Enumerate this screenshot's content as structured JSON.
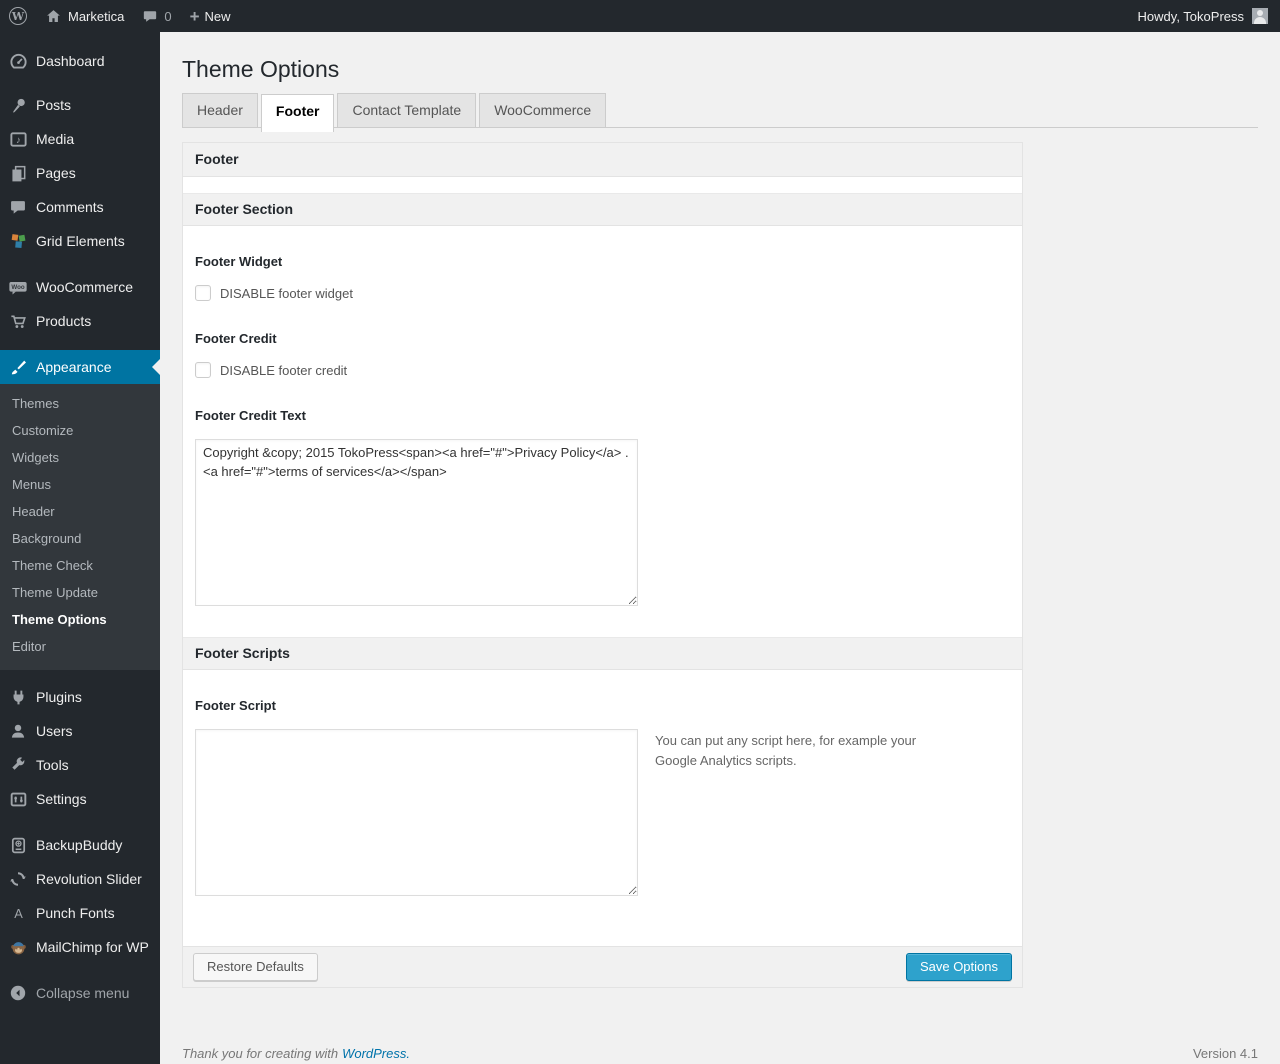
{
  "admin_bar": {
    "site_name": "Marketica",
    "comment_count": "0",
    "new_label": "New",
    "howdy_text": "Howdy, TokoPress"
  },
  "icons": {
    "wordpress_logo_glyph": "W",
    "plus_glyph": "+",
    "media_note_glyph": "♪",
    "woo_badge_glyph": "Woo",
    "punch_fonts_glyph": "A"
  },
  "sidebar": {
    "items": [
      {
        "label": "Dashboard"
      },
      {
        "label": "Posts"
      },
      {
        "label": "Media"
      },
      {
        "label": "Pages"
      },
      {
        "label": "Comments"
      },
      {
        "label": "Grid Elements"
      },
      {
        "label": "WooCommerce"
      },
      {
        "label": "Products"
      },
      {
        "label": "Appearance"
      },
      {
        "label": "Plugins"
      },
      {
        "label": "Users"
      },
      {
        "label": "Tools"
      },
      {
        "label": "Settings"
      },
      {
        "label": "BackupBuddy"
      },
      {
        "label": "Revolution Slider"
      },
      {
        "label": "Punch Fonts"
      },
      {
        "label": "MailChimp for WP"
      }
    ],
    "appearance_submenu": [
      {
        "label": "Themes"
      },
      {
        "label": "Customize"
      },
      {
        "label": "Widgets"
      },
      {
        "label": "Menus"
      },
      {
        "label": "Header"
      },
      {
        "label": "Background"
      },
      {
        "label": "Theme Check"
      },
      {
        "label": "Theme Update"
      },
      {
        "label": "Theme Options"
      },
      {
        "label": "Editor"
      }
    ],
    "collapse_label": "Collapse menu"
  },
  "page": {
    "title": "Theme Options",
    "tabs": [
      {
        "label": "Header"
      },
      {
        "label": "Footer"
      },
      {
        "label": "Contact Template"
      },
      {
        "label": "WooCommerce"
      }
    ],
    "panel": {
      "title": "Footer",
      "section1": {
        "title": "Footer Section",
        "footer_widget_label": "Footer Widget",
        "footer_widget_checkbox_label": "DISABLE footer widget",
        "footer_credit_label": "Footer Credit",
        "footer_credit_checkbox_label": "DISABLE footer credit",
        "footer_credit_text_label": "Footer Credit Text",
        "footer_credit_text_value": "Copyright &copy; 2015 TokoPress<span><a href=\"#\">Privacy Policy</a> . <a href=\"#\">terms of services</a></span>"
      },
      "section2": {
        "title": "Footer Scripts",
        "footer_script_label": "Footer Script",
        "footer_script_value": "",
        "footer_script_help": "You can put any script here, for example your Google Analytics scripts."
      },
      "restore_button_label": "Restore Defaults",
      "save_button_label": "Save Options"
    }
  },
  "footer": {
    "thanks_text": "Thank you for creating with",
    "wordpress_link": "WordPress.",
    "version": "Version 4.1"
  },
  "colors": {
    "admin_dark": "#23282d",
    "submenu_bg": "#32373c",
    "menu_active_blue": "#0074a2",
    "primary_button_blue": "#2ea2cc",
    "link_blue": "#0073aa",
    "content_bg": "#f1f1f1"
  }
}
